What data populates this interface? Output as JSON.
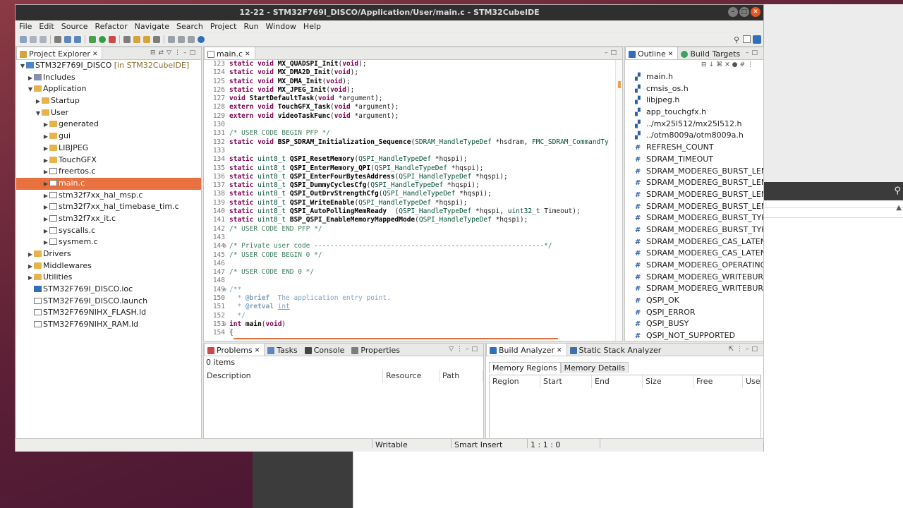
{
  "window": {
    "title": "12-22 - STM32F769I_DISCO/Application/User/main.c - STM32CubeIDE"
  },
  "menu": [
    "File",
    "Edit",
    "Source",
    "Refactor",
    "Navigate",
    "Search",
    "Project",
    "Run",
    "Window",
    "Help"
  ],
  "colors": {
    "accent": "#e9713f",
    "keyword": "#7f0055",
    "comment": "#3f7f5f",
    "type": "#005032",
    "titlebar": "#2f2f2f"
  },
  "project_explorer": {
    "tab": "Project Explorer",
    "items": [
      {
        "label": "STM32F769I_DISCO",
        "suffix": " [in STM32CubeIDE]",
        "level": 0,
        "icon": "project-icon",
        "expanded": true
      },
      {
        "label": "Includes",
        "level": 1,
        "icon": "includes-icon",
        "expanded": false
      },
      {
        "label": "Application",
        "level": 1,
        "icon": "folder-icon",
        "expanded": true
      },
      {
        "label": "Startup",
        "level": 2,
        "icon": "folder-icon",
        "expanded": false
      },
      {
        "label": "User",
        "level": 2,
        "icon": "folder-icon",
        "expanded": true
      },
      {
        "label": "generated",
        "level": 3,
        "icon": "folder-icon",
        "expanded": false
      },
      {
        "label": "gui",
        "level": 3,
        "icon": "folder-icon",
        "expanded": false
      },
      {
        "label": "LIBJPEG",
        "level": 3,
        "icon": "folder-icon",
        "expanded": false
      },
      {
        "label": "TouchGFX",
        "level": 3,
        "icon": "folder-icon",
        "expanded": false
      },
      {
        "label": "freertos.c",
        "level": 3,
        "icon": "c-file-icon",
        "expanded": false
      },
      {
        "label": "main.c",
        "level": 3,
        "icon": "c-file-icon",
        "expanded": false,
        "selected": true
      },
      {
        "label": "stm32f7xx_hal_msp.c",
        "level": 3,
        "icon": "c-file-icon",
        "expanded": false
      },
      {
        "label": "stm32f7xx_hal_timebase_tim.c",
        "level": 3,
        "icon": "c-file-icon",
        "expanded": false
      },
      {
        "label": "stm32f7xx_it.c",
        "level": 3,
        "icon": "c-file-icon",
        "expanded": false
      },
      {
        "label": "syscalls.c",
        "level": 3,
        "icon": "c-file-icon",
        "expanded": false
      },
      {
        "label": "sysmem.c",
        "level": 3,
        "icon": "c-file-icon",
        "expanded": false
      },
      {
        "label": "Drivers",
        "level": 1,
        "icon": "folder-icon",
        "expanded": false
      },
      {
        "label": "Middlewares",
        "level": 1,
        "icon": "folder-icon",
        "expanded": false
      },
      {
        "label": "Utilities",
        "level": 1,
        "icon": "folder-icon",
        "expanded": false
      },
      {
        "label": "STM32F769I_DISCO.ioc",
        "level": 1,
        "icon": "ioc-file-icon",
        "leaf": true
      },
      {
        "label": "STM32F769I_DISCO.launch",
        "level": 1,
        "icon": "launch-file-icon",
        "leaf": true
      },
      {
        "label": "STM32F769NIHX_FLASH.ld",
        "level": 1,
        "icon": "ld-file-icon",
        "leaf": true
      },
      {
        "label": "STM32F769NIHX_RAM.ld",
        "level": 1,
        "icon": "ld-file-icon",
        "leaf": true
      }
    ]
  },
  "editor": {
    "tab": "main.c",
    "lines": [
      {
        "n": "123",
        "fold": "",
        "html": "<span class='kw'>static</span> <span class='kw'>void</span> <span class='fn'>MX_QUADSPI_Init</span>(<span class='kw'>void</span>);"
      },
      {
        "n": "124",
        "fold": "",
        "html": "<span class='kw'>static</span> <span class='kw'>void</span> <span class='fn'>MX_DMA2D_Init</span>(<span class='kw'>void</span>);"
      },
      {
        "n": "125",
        "fold": "",
        "html": "<span class='kw'>static</span> <span class='kw'>void</span> <span class='fn'>MX_DMA_Init</span>(<span class='kw'>void</span>);"
      },
      {
        "n": "126",
        "fold": "",
        "html": "<span class='kw'>static</span> <span class='kw'>void</span> <span class='fn'>MX_JPEG_Init</span>(<span class='kw'>void</span>);"
      },
      {
        "n": "127",
        "fold": "",
        "html": "<span class='kw'>void</span> <span class='fn'>StartDefaultTask</span>(<span class='kw'>void</span> *argument);"
      },
      {
        "n": "128",
        "fold": "",
        "html": "<span class='kw'>extern</span> <span class='kw'>void</span> <span class='fn'>TouchGFX_Task</span>(<span class='kw'>void</span> *argument);"
      },
      {
        "n": "129",
        "fold": "",
        "html": "<span class='kw'>extern</span> <span class='kw'>void</span> <span class='fn'>videoTaskFunc</span>(<span class='kw'>void</span> *argument);"
      },
      {
        "n": "130",
        "fold": "",
        "html": ""
      },
      {
        "n": "131",
        "fold": "",
        "html": "<span class='cm'>/* USER CODE BEGIN PFP */</span>"
      },
      {
        "n": "132",
        "fold": "",
        "html": "<span class='kw'>static</span> <span class='kw'>void</span> <span class='fn'>BSP_SDRAM_Initialization_Sequence</span>(<span class='ty'>SDRAM_HandleTypeDef</span> *hsdram, <span class='ty'>FMC_SDRAM_CommandTy</span>"
      },
      {
        "n": "133",
        "fold": "",
        "html": ""
      },
      {
        "n": "134",
        "fold": "",
        "html": "<span class='kw'>static</span> <span class='ty'>uint8_t</span> <span class='fn'>QSPI_ResetMemory</span>(<span class='ty'>QSPI_HandleTypeDef</span> *hqspi);"
      },
      {
        "n": "135",
        "fold": "",
        "html": "<span class='kw'>static</span> <span class='ty'>uint8_t</span> <span class='fn'>QSPI_EnterMemory_QPI</span>(<span class='ty'>QSPI_HandleTypeDef</span> *hqspi);"
      },
      {
        "n": "136",
        "fold": "",
        "html": "<span class='kw'>static</span> <span class='ty'>uint8_t</span> <span class='fn'>QSPI_EnterFourBytesAddress</span>(<span class='ty'>QSPI_HandleTypeDef</span> *hqspi);"
      },
      {
        "n": "137",
        "fold": "",
        "html": "<span class='kw'>static</span> <span class='ty'>uint8_t</span> <span class='fn'>QSPI_DummyCyclesCfg</span>(<span class='ty'>QSPI_HandleTypeDef</span> *hqspi);"
      },
      {
        "n": "138",
        "fold": "",
        "html": "<span class='kw'>static</span> <span class='ty'>uint8_t</span> <span class='fn'>QSPI_OutDrvStrengthCfg</span>(<span class='ty'>QSPI_HandleTypeDef</span> *hqspi);"
      },
      {
        "n": "139",
        "fold": "",
        "html": "<span class='kw'>static</span> <span class='ty'>uint8_t</span> <span class='fn'>QSPI_WriteEnable</span>(<span class='ty'>QSPI_HandleTypeDef</span> *hqspi);"
      },
      {
        "n": "140",
        "fold": "",
        "html": "<span class='kw'>static</span> <span class='ty'>uint8_t</span> <span class='fn'>QSPI_AutoPollingMemReady</span>  (<span class='ty'>QSPI_HandleTypeDef</span> *hqspi, <span class='ty'>uint32_t</span> Timeout);"
      },
      {
        "n": "141",
        "fold": "",
        "html": "<span class='kw'>static</span> <span class='ty'>uint8_t</span> <span class='fn'>BSP_QSPI_EnableMemoryMappedMode</span>(<span class='ty'>QSPI_HandleTypeDef</span> *hqspi);"
      },
      {
        "n": "142",
        "fold": "",
        "html": "<span class='cm'>/* USER CODE END PFP */</span>"
      },
      {
        "n": "143",
        "fold": "",
        "html": ""
      },
      {
        "n": "144",
        "fold": "⊖",
        "html": "<span class='cm'>/* Private user code ---------------------------------------------------------*/</span>"
      },
      {
        "n": "145",
        "fold": "",
        "html": "<span class='cm'>/* USER CODE BEGIN 0 */</span>"
      },
      {
        "n": "146",
        "fold": "",
        "html": ""
      },
      {
        "n": "147",
        "fold": "",
        "html": "<span class='cm'>/* USER CODE END 0 */</span>"
      },
      {
        "n": "148",
        "fold": "",
        "html": ""
      },
      {
        "n": "149",
        "fold": "⊖",
        "html": "<span class='jd'>/**</span>"
      },
      {
        "n": "150",
        "fold": "",
        "html": "<span class='jd'>  * <b>@brief</b>  The application entry point.</span>"
      },
      {
        "n": "151",
        "fold": "",
        "html": "<span class='jd'>  * <b>@retval</b> <u>int</u></span>"
      },
      {
        "n": "152",
        "fold": "",
        "html": "<span class='jd'>  */</span>"
      },
      {
        "n": "153",
        "fold": "⊖",
        "html": "<span class='kw'>int</span> <span class='fn'>main</span>(<span class='kw'>void</span>)"
      },
      {
        "n": "154",
        "fold": "",
        "html": "{"
      }
    ]
  },
  "outline": {
    "tabs": [
      "Outline",
      "Build Targets"
    ],
    "items": [
      {
        "label": "main.h",
        "icon": "include-icon"
      },
      {
        "label": "cmsis_os.h",
        "icon": "include-icon"
      },
      {
        "label": "libjpeg.h",
        "icon": "include-icon"
      },
      {
        "label": "app_touchgfx.h",
        "icon": "include-icon"
      },
      {
        "label": "../mx25l512/mx25l512.h",
        "icon": "include-icon"
      },
      {
        "label": "../otm8009a/otm8009a.h",
        "icon": "include-icon"
      },
      {
        "label": "REFRESH_COUNT",
        "icon": "macro-icon"
      },
      {
        "label": "SDRAM_TIMEOUT",
        "icon": "macro-icon"
      },
      {
        "label": "SDRAM_MODEREG_BURST_LENGTH",
        "icon": "macro-icon"
      },
      {
        "label": "SDRAM_MODEREG_BURST_LENGTH",
        "icon": "macro-icon"
      },
      {
        "label": "SDRAM_MODEREG_BURST_LENGTH",
        "icon": "macro-icon"
      },
      {
        "label": "SDRAM_MODEREG_BURST_LENGTH",
        "icon": "macro-icon"
      },
      {
        "label": "SDRAM_MODEREG_BURST_TYPE_S",
        "icon": "macro-icon"
      },
      {
        "label": "SDRAM_MODEREG_BURST_TYPE_I",
        "icon": "macro-icon"
      },
      {
        "label": "SDRAM_MODEREG_CAS_LATENCY_",
        "icon": "macro-icon"
      },
      {
        "label": "SDRAM_MODEREG_CAS_LATENCY_",
        "icon": "macro-icon"
      },
      {
        "label": "SDRAM_MODEREG_OPERATING_M",
        "icon": "macro-icon"
      },
      {
        "label": "SDRAM_MODEREG_WRITEBURST_M",
        "icon": "macro-icon"
      },
      {
        "label": "SDRAM_MODEREG_WRITEBURST_M",
        "icon": "macro-icon"
      },
      {
        "label": "QSPI_OK",
        "icon": "macro-icon"
      },
      {
        "label": "QSPI_ERROR",
        "icon": "macro-icon"
      },
      {
        "label": "QSPI_BUSY",
        "icon": "macro-icon"
      },
      {
        "label": "QSPI_NOT_SUPPORTED",
        "icon": "macro-icon"
      }
    ]
  },
  "problems": {
    "tabs": [
      "Problems",
      "Tasks",
      "Console",
      "Properties"
    ],
    "count": "0 items",
    "columns": [
      "Description",
      "Resource",
      "Path"
    ]
  },
  "analyzer": {
    "tabs": [
      "Build Analyzer",
      "Static Stack Analyzer"
    ],
    "subtabs": [
      "Memory Regions",
      "Memory Details"
    ],
    "columns": [
      "Region",
      "Start address",
      "End address",
      "Size",
      "Free",
      "Used"
    ]
  },
  "status": {
    "writable": "Writable",
    "insert": "Smart Insert",
    "position": "1 : 1 : 0"
  }
}
